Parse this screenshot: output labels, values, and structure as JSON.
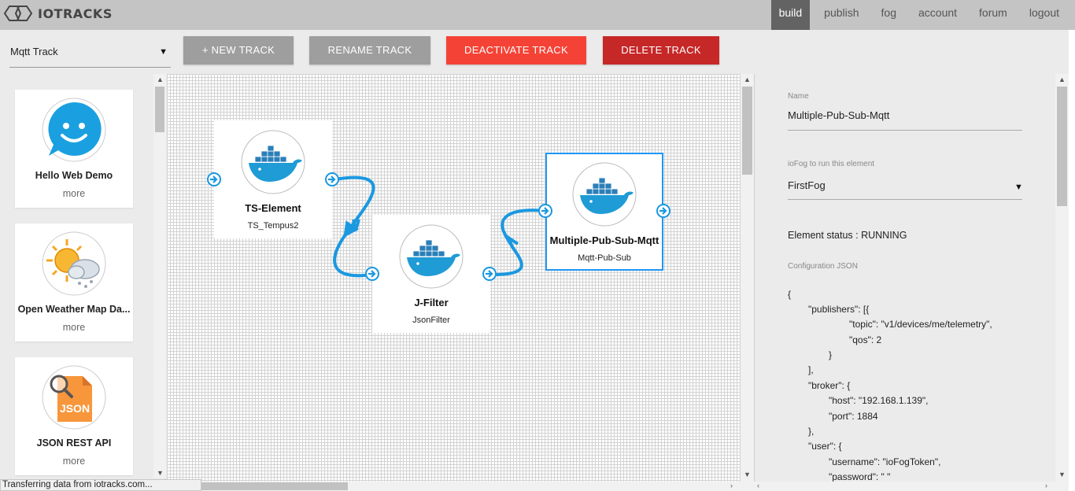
{
  "app": {
    "name": "IOTRACKS"
  },
  "nav": [
    {
      "label": "build",
      "active": true
    },
    {
      "label": "publish"
    },
    {
      "label": "fog"
    },
    {
      "label": "account"
    },
    {
      "label": "forum"
    },
    {
      "label": "logout"
    }
  ],
  "toolbar": {
    "track_select": "Mqtt Track",
    "new_track": "+ NEW TRACK",
    "rename_track": "RENAME TRACK",
    "deactivate_track": "DEACTIVATE TRACK",
    "delete_track": "DELETE TRACK"
  },
  "catalog": [
    {
      "title": "Hello Web Demo",
      "more": "more",
      "icon": "smiley-chat-icon"
    },
    {
      "title": "Open Weather Map Da...",
      "more": "more",
      "icon": "weather-icon"
    },
    {
      "title": "JSON REST API",
      "more": "more",
      "icon": "json-file-icon"
    }
  ],
  "canvas": {
    "nodes": [
      {
        "title": "TS-Element",
        "subtitle": "TS_Tempus2",
        "icon": "docker-icon"
      },
      {
        "title": "J-Filter",
        "subtitle": "JsonFilter",
        "icon": "docker-icon"
      },
      {
        "title": "Multiple-Pub-Sub-Mqtt",
        "subtitle": "Mqtt-Pub-Sub",
        "icon": "docker-icon",
        "selected": true
      }
    ],
    "connection_color": "#1a98e0"
  },
  "properties": {
    "name_label": "Name",
    "name_value": "Multiple-Pub-Sub-Mqtt",
    "iofog_label": "ioFog to run this element",
    "iofog_value": "FirstFog",
    "status": "Element status : RUNNING",
    "config_label": "Configuration JSON",
    "config_lines": [
      "{",
      "\"publishers\": [{",
      "\"topic\": \"v1/devices/me/telemetry\",",
      "\"qos\": 2",
      "}",
      "],",
      "\"broker\": {",
      "\"host\": \"192.168.1.139\",",
      "\"port\": 1884",
      "},",
      "\"user\": {",
      "\"username\": \"ioFogToken\",",
      "\"password\": \" \""
    ]
  },
  "statusbar": "Transferring data from iotracks.com...",
  "colors": {
    "topbar": "#c4c4c4",
    "nav_active": "#636363",
    "btn_gray": "#9e9e9e",
    "btn_red": "#f44336",
    "btn_darkred": "#c62828",
    "selected_border": "#2196f3"
  }
}
